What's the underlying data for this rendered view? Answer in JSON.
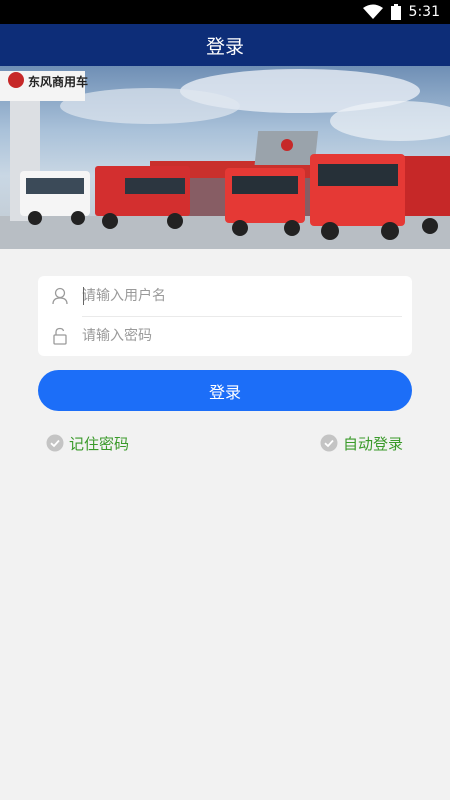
{
  "status_bar": {
    "time": "5:31",
    "icons": [
      "wifi-icon",
      "battery-icon"
    ]
  },
  "app_bar": {
    "title": "登录"
  },
  "banner": {
    "brand_text": "东风商用车",
    "image_description_icon": "truck-banner-image"
  },
  "login_form": {
    "username": {
      "placeholder": "请输入用户名",
      "value": "",
      "icon": "user-icon"
    },
    "password": {
      "placeholder": "请输入密码",
      "value": "",
      "icon": "lock-icon"
    },
    "submit_label": "登录",
    "remember_password_label": "记住密码",
    "auto_login_label": "自动登录"
  },
  "colors": {
    "app_bar": "#0d2d78",
    "button": "#1c6ef8",
    "option_text": "#3a9a2a",
    "background": "#f2f2f2"
  }
}
